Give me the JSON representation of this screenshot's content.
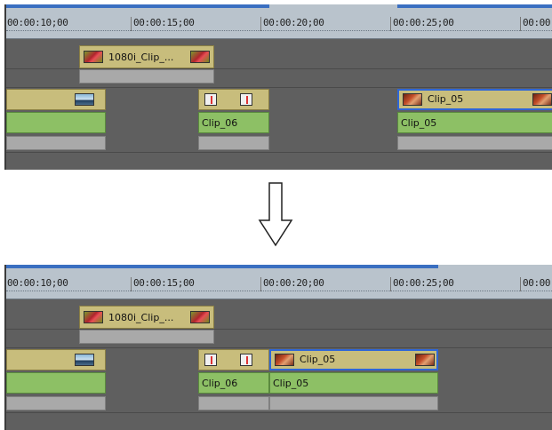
{
  "timeline": {
    "ruler_ticks": [
      "00:00:10;00",
      "00:00:15;00",
      "00:00:20;00",
      "00:00:25;00",
      "00:00"
    ]
  },
  "before": {
    "clips": {
      "title_1080i": "1080i_Clip_...",
      "clip_06": "Clip_06",
      "clip_05_title": "Clip_05",
      "clip_05_video": "Clip_05"
    }
  },
  "after": {
    "clips": {
      "title_1080i": "1080i_Clip_...",
      "clip_06": "Clip_06",
      "clip_05_title": "Clip_05",
      "clip_05_video": "Clip_05"
    }
  },
  "icons": {
    "transition_arrow": "down-arrow-icon"
  },
  "colors": {
    "selection": "#2f66d6",
    "title_track": "#c8bd7c",
    "video_track": "#8dc065",
    "audio_track": "#a9a9a9"
  }
}
